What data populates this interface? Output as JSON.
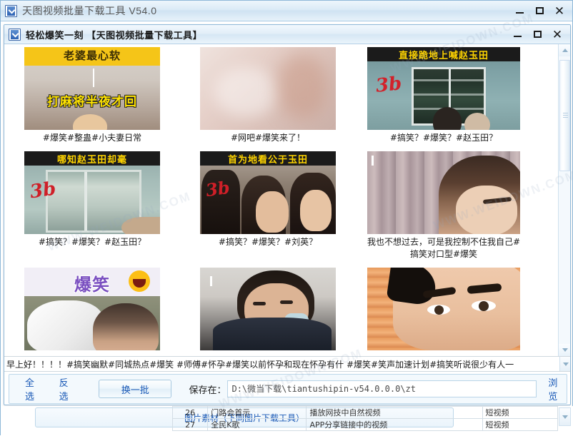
{
  "app": {
    "title": "天图视频批量下载工具  V54.0",
    "icon": "download-arrow-icon",
    "window_controls": {
      "minimize": "−",
      "maximize": "□",
      "close": "✕"
    }
  },
  "dialog": {
    "title": "轻松爆笑一刻 【天图视频批量下载工具】",
    "icon": "download-arrow-icon",
    "window_controls": {
      "minimize": "−",
      "maximize": "□",
      "close": "✕"
    }
  },
  "grid": {
    "rows": [
      {
        "cells": [
          {
            "caption": "#爆笑#整蛊#小夫妻日常",
            "art": "art-a",
            "banner_text": "老婆最心软",
            "mid_text": "打麻将半夜才回"
          },
          {
            "caption": "#网吧#爆笑来了！",
            "art": "art-b",
            "banner_text": "",
            "mid_text": ""
          },
          {
            "caption": "#搞笑？#爆笑？#赵玉田？",
            "art": "art-c",
            "banner_text": "直接跪地上喊赵玉田",
            "mid_text": ""
          }
        ]
      },
      {
        "cells": [
          {
            "caption": "#搞笑？#爆笑？#赵玉田？",
            "art": "art-d",
            "banner_text": "哪知赵玉田却毫",
            "mid_text": ""
          },
          {
            "caption": "#搞笑？#爆笑？#刘英？",
            "art": "art-e",
            "banner_text": "首为地看公于玉田",
            "mid_text": ""
          },
          {
            "caption": "我也不想过去，可是我控制不住我自己#搞笑对口型#爆笑",
            "art": "art-f",
            "banner_text": "",
            "mid_text": ""
          }
        ]
      },
      {
        "cells": [
          {
            "caption": "",
            "art": "art-g",
            "banner_text": "爆笑",
            "mid_text": ""
          },
          {
            "caption": "",
            "art": "art-h",
            "banner_text": "",
            "mid_text": ""
          },
          {
            "caption": "",
            "art": "art-i",
            "banner_text": "",
            "mid_text": ""
          }
        ]
      }
    ]
  },
  "ticker": {
    "text": "早上好！！！！#搞笑幽默#同城热点#爆笑  #师傅#怀孕#爆笑以前怀孕和现在怀孕有什  #爆笑#笑声加速计划#搞笑听说很少有人一",
    "dropdown_icon": "chevron-down-icon"
  },
  "controls": {
    "select_all": "全选",
    "invert_select": "反选",
    "refresh_batch": "换一批",
    "save_to_label": "保存在：",
    "path_value": "D:\\微当下载\\tiantushipin-v54.0.0.0\\zt",
    "browse": "浏览"
  },
  "background": {
    "wide_button": "图片素材（下同图片下载工具）",
    "table_rows": [
      {
        "c0": "26",
        "c1": "门路会首示",
        "c2": "播放网技中自然视频",
        "c3": "短视频"
      },
      {
        "c0": "27",
        "c1": "全民K歌",
        "c2": "APP分享链接中的视频",
        "c3": "短视频"
      }
    ],
    "scroll_icon": "chevron-down-icon"
  },
  "scrollbar": {
    "up_icon": "chevron-up-icon",
    "down_icon": "chevron-down-icon"
  },
  "watermarks": [
    "WWW.WEIDOWN.COM",
    "WWW.WEIDOWN.COM",
    "WWW.WEIDOWN.COM",
    "WWW.WEIDOWN.COM"
  ],
  "colors": {
    "accent_link": "#1757b5",
    "titlebar": "#dbeaf6",
    "border": "#8fb8d8"
  }
}
